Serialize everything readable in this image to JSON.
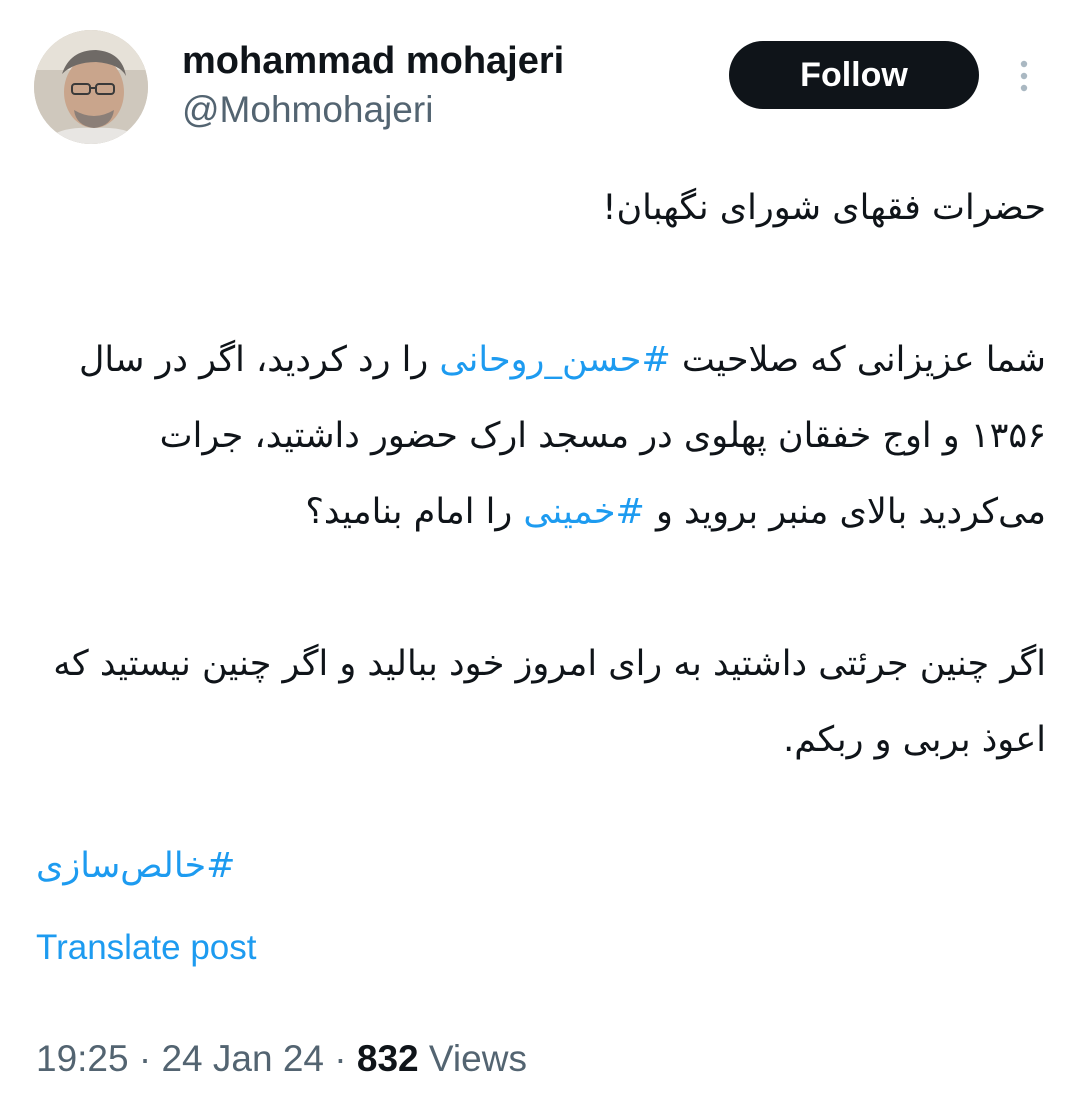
{
  "author": {
    "display_name": "mohammad mohajeri",
    "handle": "@Mohmohajeri"
  },
  "actions": {
    "follow_label": "Follow",
    "more_icon": "more-vertical-icon"
  },
  "tweet": {
    "line1": "حضرات فقهای شورای نگهبان!",
    "p2_before": "شما عزیزانی که صلاحیت ",
    "p2_hashtag1": "#حسن_روحانی",
    "p2_middle": " را رد کردید، اگر در سال ۱۳۵۶ و اوج خفقان پهلوی در مسجد ارک حضور داشتید، جرات می‌کردید بالای منبر بروید و ",
    "p2_hashtag2": "#خمینی",
    "p2_after": " را امام بنامید؟",
    "p3": "اگر چنین جرئتی داشتید به رای امروز خود ببالید و اگر چنین نیستید که اعوذ بربی و ربکم.",
    "hashtag_final": "#خالص‌سازی"
  },
  "translate_label": "Translate post",
  "meta": {
    "time": "19:25",
    "date": "24 Jan 24",
    "separator": " · ",
    "views_count": "832",
    "views_label": " Views"
  },
  "colors": {
    "link": "#1d9bf0",
    "text": "#0f1419",
    "secondary": "#536471",
    "button": "#0f1419"
  }
}
